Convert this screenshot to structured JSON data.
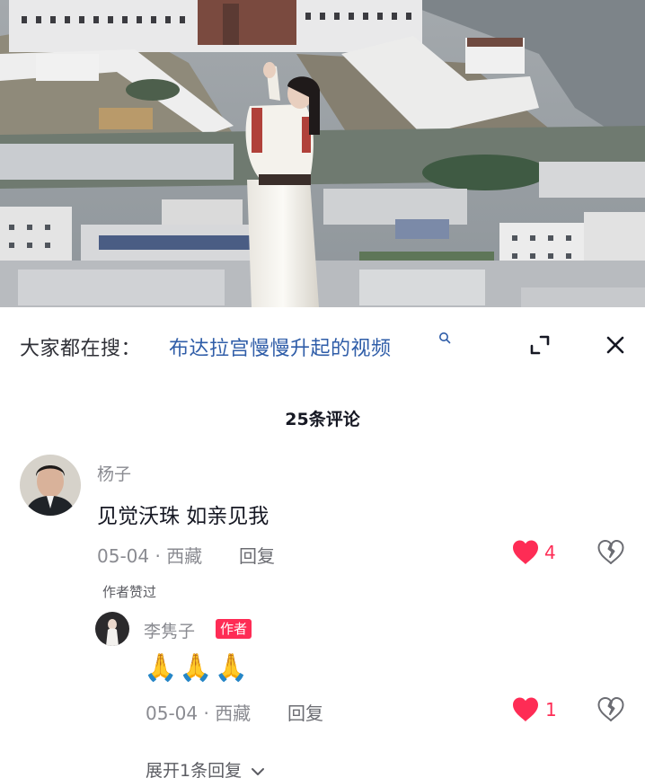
{
  "search": {
    "prefix": "大家都在搜：",
    "query": "布达拉宫慢慢升起的视频"
  },
  "comments": {
    "count_label": "25条评论",
    "items": [
      {
        "user": "杨子",
        "text": "见觉沃珠 如亲见我",
        "date_location": "05-04 · 西藏",
        "reply_label": "回复",
        "likes": "4",
        "author_liked_label": "作者赞过",
        "replies": [
          {
            "user": "李隽子",
            "badge": "作者",
            "text": "🙏🙏🙏",
            "date_location": "05-04 · 西藏",
            "reply_label": "回复",
            "likes": "1"
          }
        ],
        "expand_label": "展开1条回复"
      }
    ]
  },
  "icons": {
    "search": "search-icon",
    "expand": "expand-icon",
    "close": "close-icon",
    "like": "heart-icon",
    "dislike": "broken-heart-icon",
    "chevron": "chevron-down-icon"
  },
  "colors": {
    "like_red": "#fe2c55",
    "link_blue": "#2f5da8",
    "muted_gray": "#8a8b91"
  }
}
